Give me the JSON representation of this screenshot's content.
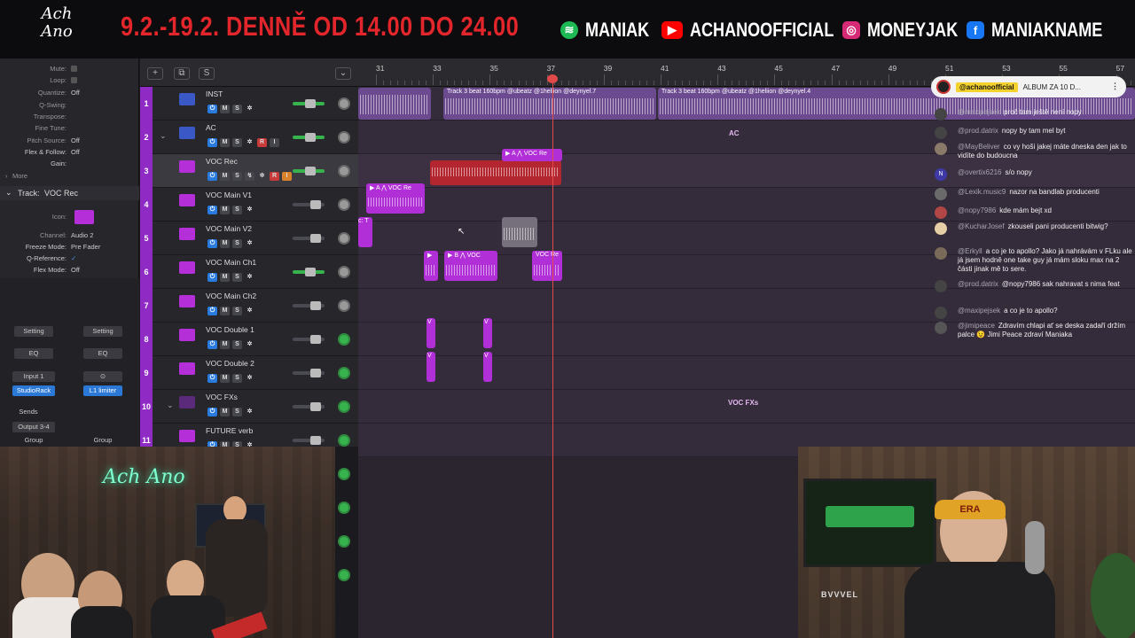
{
  "banner": {
    "logo": "Ach Ano",
    "dates": "9.2.-19.2. DENNĚ OD 14.00 DO 24.00",
    "socials": [
      {
        "icon": "spotify-icon",
        "label": "MANIAK",
        "color": "#1db954"
      },
      {
        "icon": "youtube-icon",
        "label": "ACHANOOFFICIAL",
        "color": "#ff0000"
      },
      {
        "icon": "instagram-icon",
        "label": "MONEYJAK",
        "color": "#d62976"
      },
      {
        "icon": "facebook-icon",
        "label": "MANIAKNAME",
        "color": "#1877f2"
      }
    ]
  },
  "inspector": {
    "rows": [
      {
        "label": "Mute:",
        "value": ""
      },
      {
        "label": "Loop:",
        "value": ""
      },
      {
        "label": "Quantize:",
        "value": "Off"
      },
      {
        "label": "Q-Swing:",
        "value": ""
      },
      {
        "label": "Transpose:",
        "value": ""
      },
      {
        "label": "Fine Tune:",
        "value": ""
      },
      {
        "label": "Pitch Source:",
        "value": "Off"
      },
      {
        "label": "Flex & Follow:",
        "value": "Off"
      },
      {
        "label": "Gain:",
        "value": ""
      }
    ],
    "more": "More",
    "track_label": "Track:",
    "track_name": "VOC Rec",
    "track_rows": [
      {
        "label": "Icon:",
        "value": ""
      },
      {
        "label": "Channel:",
        "value": "Audio 2"
      },
      {
        "label": "Freeze Mode:",
        "value": "Pre Fader"
      },
      {
        "label": "Q-Reference:",
        "value": "✓"
      },
      {
        "label": "Flex Mode:",
        "value": "Off"
      }
    ],
    "setting": "Setting",
    "eq": "EQ",
    "input": "Input 1",
    "studiorack": "StudioRack",
    "l1": "L1 limiter",
    "sends": "Sends",
    "output": "Output 3-4",
    "group": "Group"
  },
  "toolbar": {
    "add": "+",
    "dup": "⧉",
    "s": "S",
    "tool": "⌄"
  },
  "tracks": [
    {
      "num": "1",
      "name": "INST",
      "icon": "blue",
      "rec": false,
      "fader_on": true,
      "knob": "gray"
    },
    {
      "num": "2",
      "name": "AC",
      "icon": "blue",
      "rec": true,
      "fader_on": true,
      "knob": "gray"
    },
    {
      "num": "3",
      "name": "VOC Rec",
      "icon": "mag",
      "rec": true,
      "fader_on": true,
      "knob": "gray"
    },
    {
      "num": "4",
      "name": "VOC Main V1",
      "icon": "mag",
      "rec": false,
      "fader_on": false,
      "knob": "gray"
    },
    {
      "num": "5",
      "name": "VOC Main V2",
      "icon": "mag",
      "rec": false,
      "fader_on": false,
      "knob": "gray"
    },
    {
      "num": "6",
      "name": "VOC Main Ch1",
      "icon": "mag",
      "rec": false,
      "fader_on": true,
      "knob": "gray"
    },
    {
      "num": "7",
      "name": "VOC Main Ch2",
      "icon": "mag",
      "rec": false,
      "fader_on": false,
      "knob": "gray"
    },
    {
      "num": "8",
      "name": "VOC Double 1",
      "icon": "mag",
      "rec": false,
      "fader_on": false,
      "knob": "green"
    },
    {
      "num": "9",
      "name": "VOC Double 2",
      "icon": "mag",
      "rec": false,
      "fader_on": false,
      "knob": "green"
    },
    {
      "num": "10",
      "name": "VOC FXs",
      "icon": "dark",
      "rec": false,
      "fader_on": false,
      "knob": "green"
    },
    {
      "num": "11",
      "name": "FUTURE verb",
      "icon": "mag",
      "rec": false,
      "fader_on": false,
      "knob": "green"
    }
  ],
  "ruler": {
    "bars": [
      "31",
      "33",
      "35",
      "37",
      "39",
      "41",
      "43",
      "45",
      "47",
      "49",
      "51",
      "53",
      "55",
      "57"
    ]
  },
  "regions": {
    "inst_1": "Track 3 beat 160bpm @ubeatz @1heliion @deynyel.7",
    "inst_2": "Track 3 beat 160bpm @ubeatz @1heliion @deynyel.4",
    "voc_rec": "▶ A ⋀ VOC Re",
    "voc_v1": "▶ A ⋀ VOC Re",
    "voc_v2": "c: T",
    "voc_ch1_a": "▶",
    "voc_ch1_b": "▶ B ⋀ VOC",
    "voc_ch1_c": "VOC Re",
    "double_v": "V",
    "ac_label": "AC",
    "fx_label": "VOC FXs"
  },
  "chat": {
    "pinned_user": "@achanoofficial",
    "pinned_text": "ALBUM ZA 10 D...",
    "messages": [
      {
        "user": "@maxipejsek",
        "text": "proč tam ještě není nopy",
        "av": ""
      },
      {
        "user": "@prod.datrix",
        "text": "nopy by tam mel byt",
        "av": ""
      },
      {
        "user": "@MayBeliver",
        "text": "co vy hoši jakej máte dneska den jak to vidíte do budoucna",
        "av": ""
      },
      {
        "user": "@overtix6216",
        "text": "s/o nopy",
        "av": "N"
      },
      {
        "user": "@Lexik.music9",
        "text": "nazor na bandlab producenti",
        "av": ""
      },
      {
        "user": "@nopy7986",
        "text": "kde mám bejt xd",
        "av": ""
      },
      {
        "user": "@KucharJosef",
        "text": "zkouseli pani producenti bitwig?",
        "av": ""
      },
      {
        "user": "@Erkyll",
        "text": "a co je to apollo? Jako já nahrávám v FLku ale já jsem hodně one take guy já mám sloku max na 2 části jinak mě to sere.",
        "av": ""
      },
      {
        "user": "@prod.datrix",
        "text": "@nopy7986 sak nahravat s nima feat",
        "av": ""
      },
      {
        "user": "@maxipejsek",
        "text": "a co je to apollo?",
        "av": ""
      },
      {
        "user": "@jimipeace",
        "text": "Zdravím chlapi ať se deska zadaří držím palce 😉 Jimi Peace zdraví Maniaka",
        "av": ""
      }
    ]
  },
  "cam_left": {
    "neon": "Ach Ano"
  },
  "cam_right": {
    "hat": "ERA",
    "monitor_text": "BVVVEL"
  }
}
